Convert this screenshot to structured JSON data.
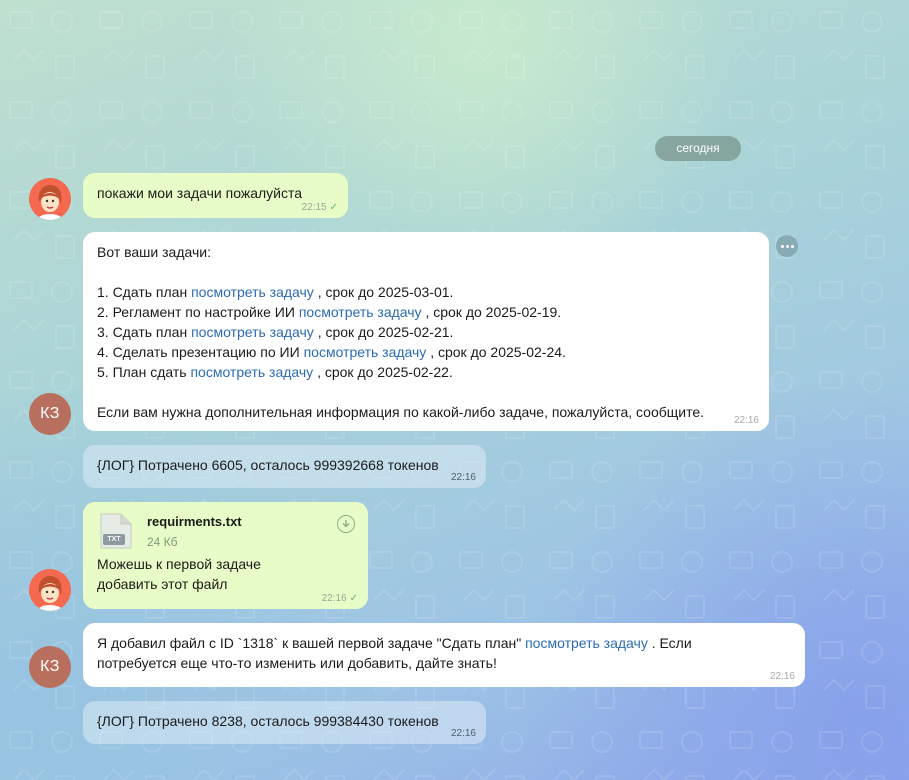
{
  "chat": {
    "date_divider": "сегодня",
    "messages": [
      {
        "text": "покажи мои задачи пожалуйста",
        "time": "22:15"
      },
      {
        "intro": "Вот ваши задачи:",
        "tasks": [
          {
            "pre": "1. Сдать план ",
            "link": "посмотреть задачу",
            "post": " , срок до 2025-03-01."
          },
          {
            "pre": "2. Регламент по настройке ИИ ",
            "link": "посмотреть задачу",
            "post": " , срок до 2025-02-19."
          },
          {
            "pre": "3. Сдать план ",
            "link": "посмотреть задачу",
            "post": " , срок до 2025-02-21."
          },
          {
            "pre": "4. Сделать презентацию по ИИ ",
            "link": "посмотреть задачу",
            "post": " , срок до 2025-02-24."
          },
          {
            "pre": "5. План сдать ",
            "link": "посмотреть задачу",
            "post": " , срок до 2025-02-22."
          }
        ],
        "outro": "Если вам нужна дополнительная информация по какой-либо задаче, пожалуйста, сообщите.",
        "time": "22:16"
      },
      {
        "text": "{ЛОГ} Потрачено 6605, осталось 999392668 токенов",
        "time": "22:16"
      },
      {
        "file_name": "requirments.txt",
        "file_size": "24 Кб",
        "file_ext": "TXT",
        "caption_line1": "Можешь к первой задаче",
        "caption_line2": "добавить этот файл",
        "time": "22:16"
      },
      {
        "line1_pre": "Я добавил файл с ID `1318` к вашей первой задаче \"Сдать план\" ",
        "line1_link": "посмотреть задачу",
        "line1_post": " . Если",
        "line2": "потребуется еще что-то изменить или добавить, дайте знать!",
        "time": "22:16"
      },
      {
        "text": "{ЛОГ} Потрачено 8238, осталось 999384430 токенов",
        "time": "22:16"
      }
    ],
    "bot_avatar_initials": "КЗ",
    "check_icon": "✓"
  },
  "colors": {
    "outgoing_bubble": "#e8fcc7",
    "incoming_bubble": "#ffffff",
    "link": "#2a6bb5",
    "bot_avatar": "#b96f5d",
    "user_avatar": "#f4694f"
  }
}
